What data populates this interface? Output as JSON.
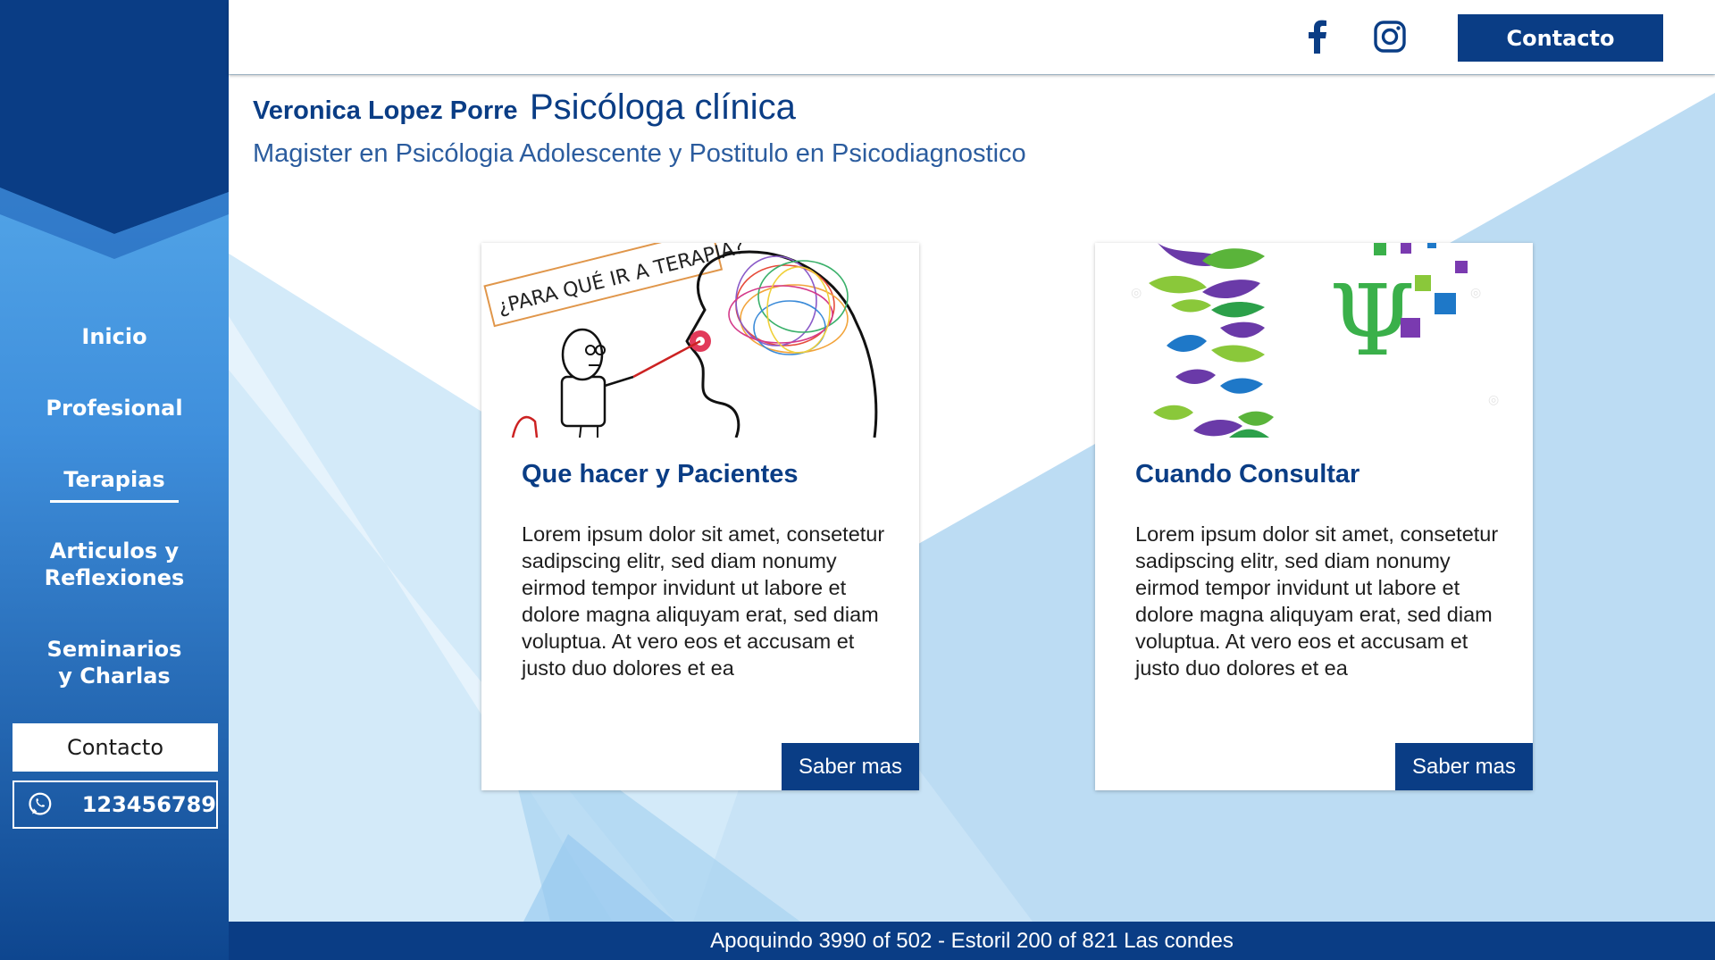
{
  "sidebar": {
    "nav": [
      {
        "label": "Inicio"
      },
      {
        "label": "Profesional"
      },
      {
        "label": "Terapias"
      },
      {
        "label": "Articulos y\nReflexiones"
      },
      {
        "label": "Seminarios\ny Charlas"
      }
    ],
    "contact_label": "Contacto",
    "phone": "123456789",
    "phone_icon": "whatsapp-icon"
  },
  "topbar": {
    "icons": [
      "facebook-icon",
      "instagram-icon"
    ],
    "contact_label": "Contacto"
  },
  "header": {
    "name": "Veronica Lopez Porre",
    "profession": "Psicóloga clínica",
    "subtitle": "Magister en Psicólogia Adolescente y Postitulo en Psicodiagnostico"
  },
  "cards": [
    {
      "image_text": "¿PARA QUÉ IR A TERAPIA?",
      "title": "Que hacer y Pacientes",
      "body": "Lorem ipsum dolor sit amet, consetetur sadipscing elitr, sed diam nonumy eirmod tempor invidunt ut labore et dolore magna aliquyam erat, sed diam voluptua. At vero eos et accusam et justo duo dolores et ea",
      "button": "Saber mas"
    },
    {
      "image_text": "Ψ",
      "title": "Cuando Consultar",
      "body": "Lorem ipsum dolor sit amet, consetetur sadipscing elitr, sed diam nonumy eirmod tempor invidunt ut labore et dolore magna aliquyam erat, sed diam voluptua. At vero eos et accusam et justo duo dolores et ea",
      "button": "Saber mas"
    }
  ],
  "footer": {
    "address": "Apoquindo 3990 of 502 - Estoril 200 of 821  Las condes"
  },
  "colors": {
    "primary": "#0a3d85",
    "sidebar_top": "#0a3d85",
    "sidebar_light": "#4aa3e8",
    "background": "#c6e2f5"
  }
}
